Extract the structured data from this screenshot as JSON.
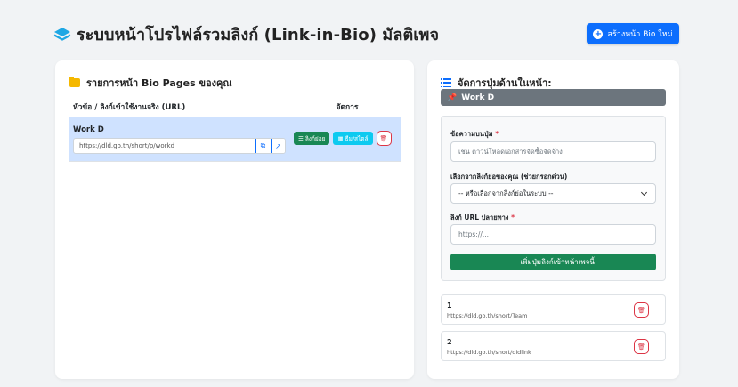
{
  "header": {
    "title": "ระบบหน้าโปรไฟล์รวมลิงก์ (Link-in-Bio) มัลติเพจ",
    "create_button": "สร้างหน้า Bio ใหม่"
  },
  "pages_card": {
    "title": "รายการหน้า Bio Pages ของคุณ",
    "columns": [
      "หัวข้อ / ลิงก์เข้าใช้งานจริง (URL)",
      "จัดการ"
    ],
    "rows": [
      {
        "title": "Work D",
        "url": "https://dld.go.th/short/p/workd",
        "sub_links_button": "ลิงก์ย่อย",
        "theme_button": "ธีม/สไตล์"
      }
    ]
  },
  "buttons_card": {
    "title": "จัดการปุ่มด้านในหน้า:",
    "current_page": "Work D",
    "form": {
      "button_text_label": "ข้อความบนปุ่ม",
      "button_text_placeholder": "เช่น ดาวน์โหลดเอกสารจัดซื้อจัดจ้าง",
      "pick_label": "เลือกจากลิงก์ย่อของคุณ (ช่วยกรอกด่วน)",
      "pick_selected": "-- หรือเลือกจากลิงก์ย่อในระบบ --",
      "url_label": "ลิงก์ URL ปลายทาง",
      "url_placeholder": "https://...",
      "required_mark": "*",
      "add_button": "+ เพิ่มปุ่มลิงก์เข้าหน้าเพจนี้"
    },
    "links": [
      {
        "label": "1",
        "url": "https://dld.go.th/short/Team"
      },
      {
        "label": "2",
        "url": "https://dld.go.th/short/didlink"
      }
    ]
  },
  "colors": {
    "primary": "#0d6efd",
    "success": "#198754",
    "info": "#0dcaf0",
    "danger": "#dc3545",
    "selected_row": "#cfe2ff",
    "page_bar": "#6c757d"
  }
}
